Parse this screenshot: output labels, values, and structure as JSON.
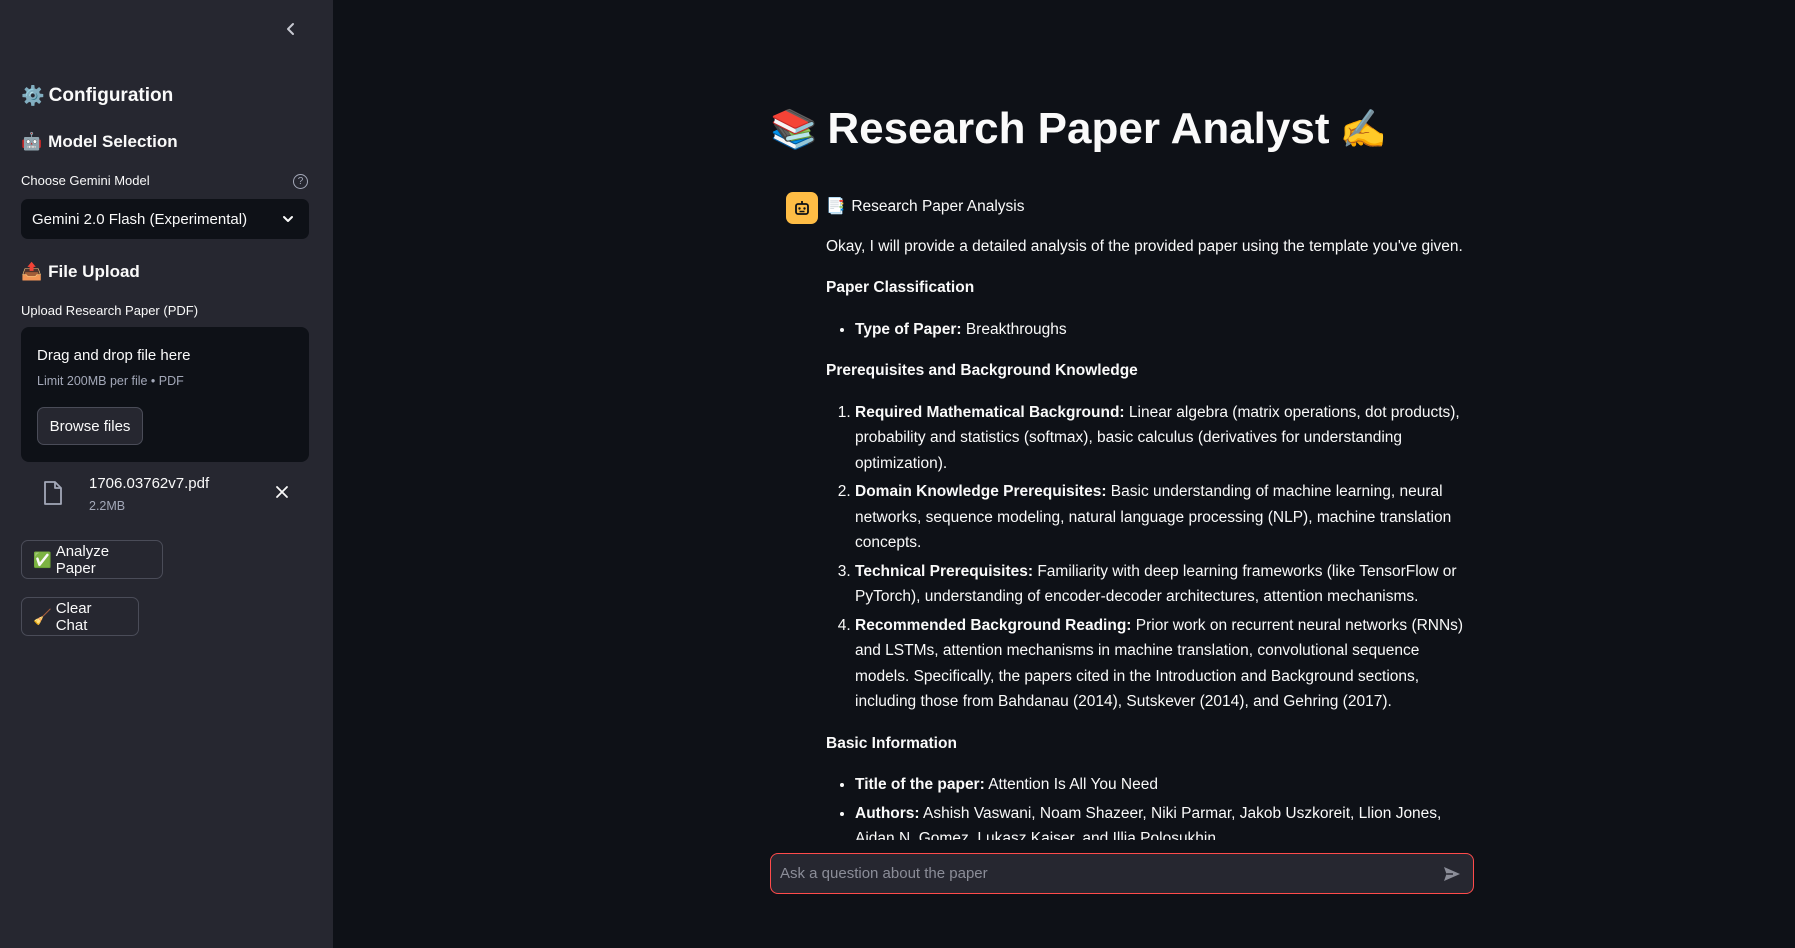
{
  "sidebar": {
    "configuration": {
      "emoji": "⚙️",
      "title": "Configuration"
    },
    "model_selection": {
      "emoji": "🤖",
      "title": "Model Selection"
    },
    "model_label": "Choose Gemini Model",
    "help_glyph": "?",
    "model_value": "Gemini 2.0 Flash (Experimental)",
    "file_upload": {
      "emoji": "📤",
      "title": "File Upload"
    },
    "upload_label": "Upload Research Paper (PDF)",
    "dropzone": {
      "title": "Drag and drop file here",
      "limit": "Limit 200MB per file • PDF",
      "browse_label": "Browse files"
    },
    "file": {
      "name": "1706.03762v7.pdf",
      "size": "2.2MB"
    },
    "analyze_button": {
      "emoji": "✅",
      "label": "Analyze Paper"
    },
    "clear_button": {
      "emoji": "🧹",
      "label": "Clear Chat"
    }
  },
  "main": {
    "title": {
      "emoji_left": "📚",
      "text": "Research Paper Analyst",
      "emoji_right": "✍️"
    },
    "message": {
      "header_emoji": "📑",
      "header": "Research Paper Analysis",
      "intro": "Okay, I will provide a detailed analysis of the provided paper using the template you've given.",
      "classification_heading": "Paper Classification",
      "classification": {
        "label": "Type of Paper:",
        "value": " Breakthroughs"
      },
      "prereq_heading": "Prerequisites and Background Knowledge",
      "prereqs": [
        {
          "label": "Required Mathematical Background:",
          "text": " Linear algebra (matrix operations, dot products), probability and statistics (softmax), basic calculus (derivatives for understanding optimization)."
        },
        {
          "label": "Domain Knowledge Prerequisites:",
          "text": " Basic understanding of machine learning, neural networks, sequence modeling, natural language processing (NLP), machine translation concepts."
        },
        {
          "label": "Technical Prerequisites:",
          "text": " Familiarity with deep learning frameworks (like TensorFlow or PyTorch), understanding of encoder-decoder architectures, attention mechanisms."
        },
        {
          "label": "Recommended Background Reading:",
          "text": " Prior work on recurrent neural networks (RNNs) and LSTMs, attention mechanisms in machine translation, convolutional sequence models. Specifically, the papers cited in the Introduction and Background sections, including those from Bahdanau (2014), Sutskever (2014), and Gehring (2017)."
        }
      ],
      "basic_heading": "Basic Information",
      "basic": [
        {
          "label": "Title of the paper:",
          "text": " Attention Is All You Need"
        },
        {
          "label": "Authors:",
          "text": " Ashish Vaswani, Noam Shazeer, Niki Parmar, Jakob Uszkoreit, Llion Jones, Aidan N. Gomez, Lukasz Kaiser, and Illia Polosukhin"
        }
      ]
    },
    "chat_input": {
      "placeholder": "Ask a question about the paper",
      "value": ""
    }
  },
  "colors": {
    "background": "#0e1117",
    "sidebar": "#262730",
    "accent": "#ff4b4b",
    "avatar": "#ffbd45"
  }
}
